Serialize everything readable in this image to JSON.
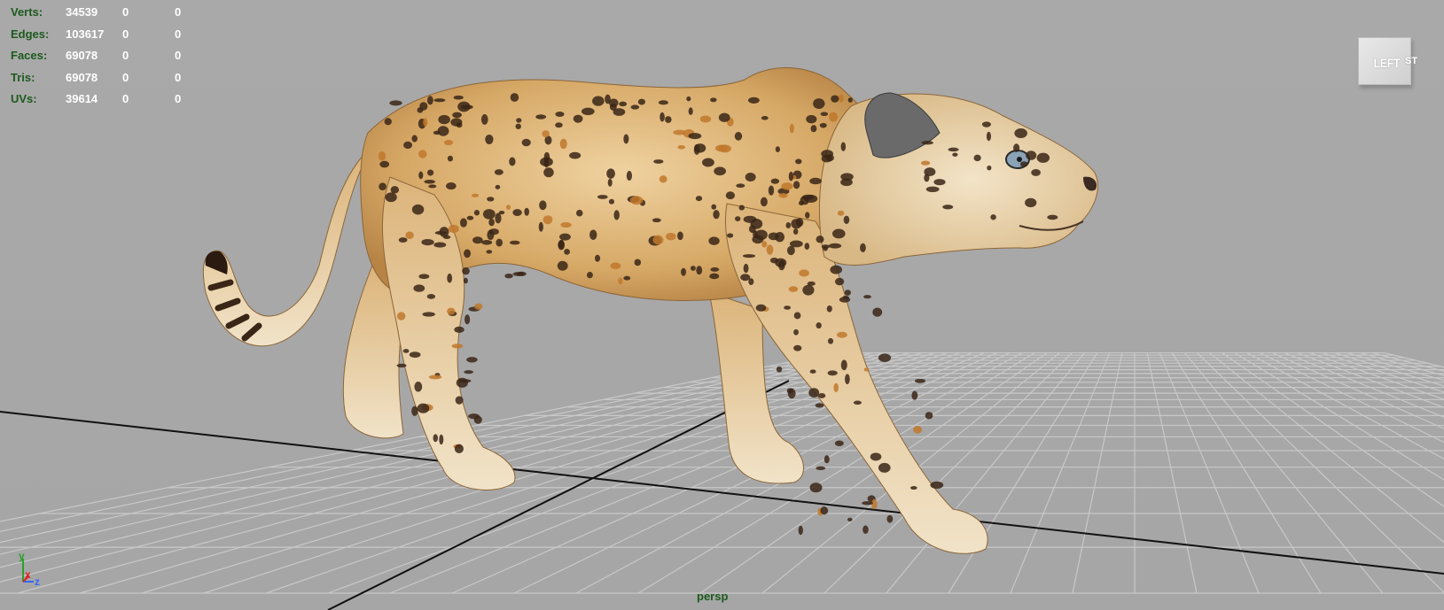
{
  "hud": {
    "rows": [
      {
        "label": "Verts:",
        "c1": "34539",
        "c2": "0",
        "c3": "0"
      },
      {
        "label": "Edges:",
        "c1": "103617",
        "c2": "0",
        "c3": "0"
      },
      {
        "label": "Faces:",
        "c1": "69078",
        "c2": "0",
        "c3": "0"
      },
      {
        "label": "Tris:",
        "c1": "69078",
        "c2": "0",
        "c3": "0"
      },
      {
        "label": "UVs:",
        "c1": "39614",
        "c2": "0",
        "c3": "0"
      }
    ]
  },
  "view_cube": {
    "label": "LEFT",
    "side_label": "ST"
  },
  "camera": {
    "label": "persp"
  },
  "axis": {
    "y": "y",
    "x": "x",
    "z": "z"
  },
  "colors": {
    "viewport_bg": "#a8a8a8",
    "hud_label": "#1d5a1d",
    "hud_value": "#ffffff",
    "grid_line": "#c8c8c8",
    "axis_line": "#111111",
    "fur": "#d9b27a",
    "spot": "#3a2616"
  },
  "model": {
    "name": "leopard",
    "icon": "leopard-mesh"
  }
}
